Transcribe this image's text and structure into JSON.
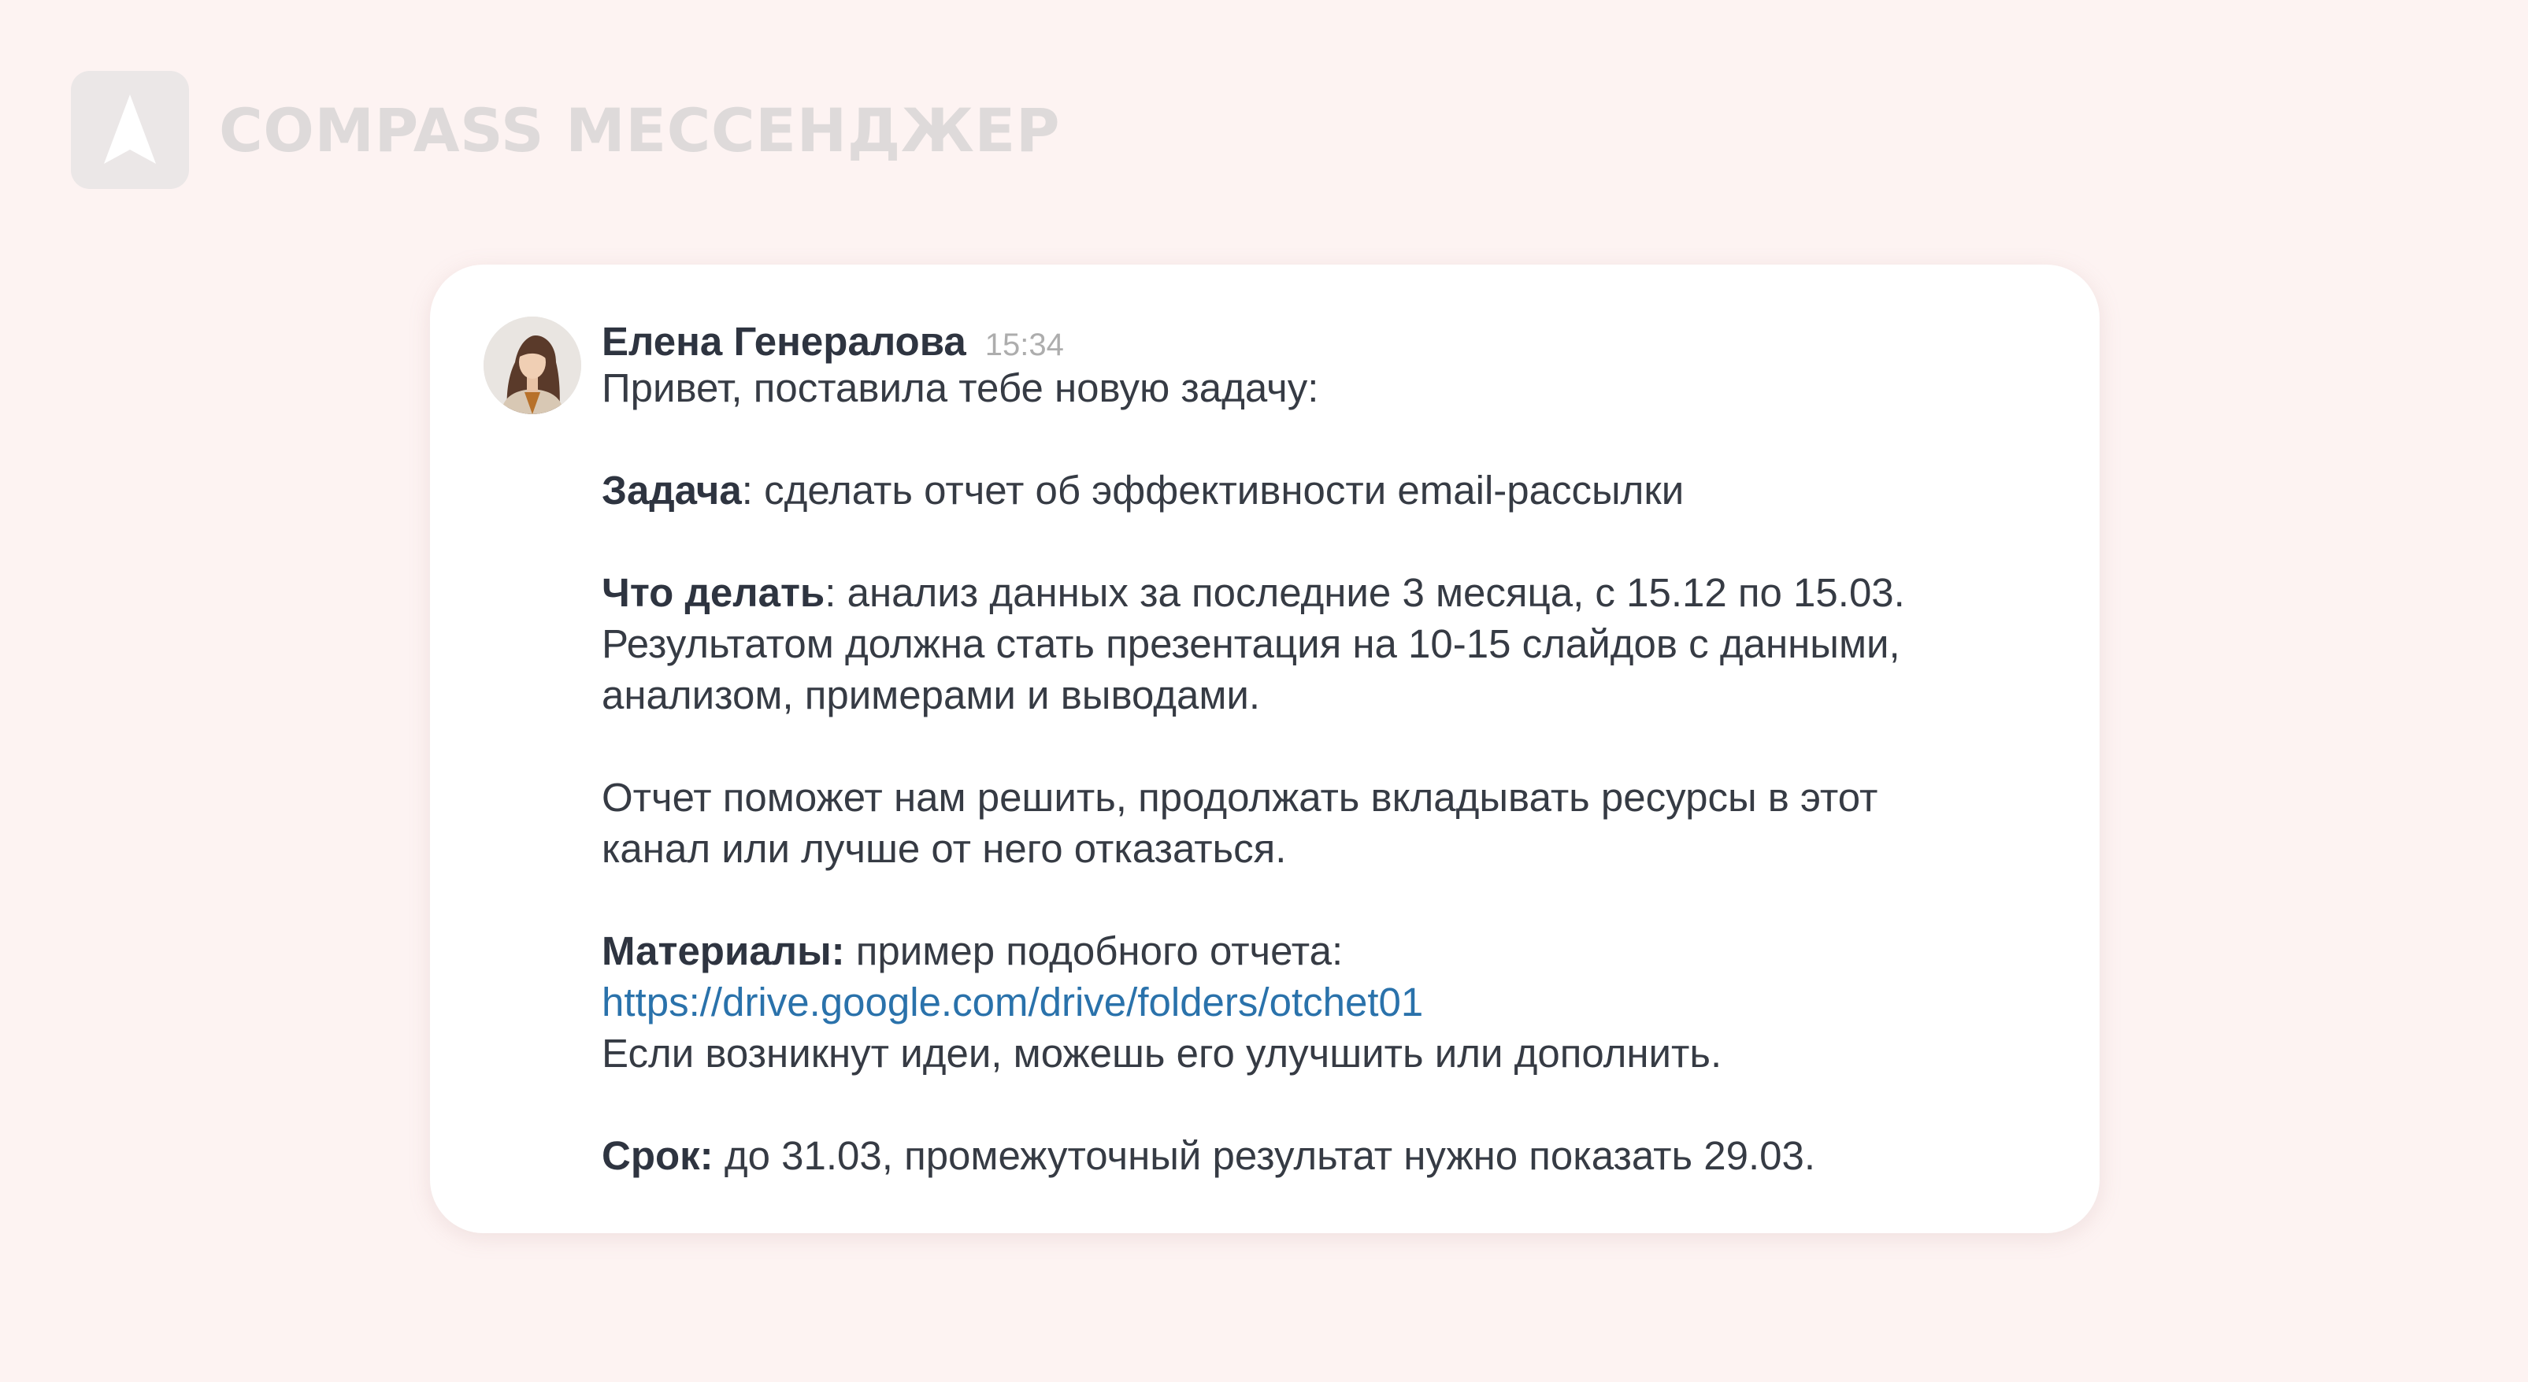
{
  "brand": {
    "name": "COMPASS МЕССЕНДЖЕР",
    "logo_icon": "compass-arrow-icon"
  },
  "colors": {
    "background": "#fdf3f2",
    "card": "#ffffff",
    "text": "#363b44",
    "link": "#2a72ab",
    "time": "#adadad",
    "brand_text": "#dedada"
  },
  "message": {
    "sender": "Елена Генералова",
    "time": "15:34",
    "avatar_icon": "user-avatar",
    "greeting": "Привет, поставила тебе новую задачу:",
    "task_label": "Задача",
    "task_text": ": сделать отчет об эффективности email-рассылки",
    "todo_label": "Что делать",
    "todo_line1": ": анализ данных за последние 3 месяца, с 15.12 по 15.03.",
    "todo_line2": "Результатом должна стать презентация на 10-15 слайдов с данными,",
    "todo_line3": "анализом, примерами и выводами.",
    "purpose_line1": "Отчет поможет нам решить, продолжать вкладывать ресурсы в этот",
    "purpose_line2": "канал или лучше от него отказаться.",
    "materials_label": "Материалы:",
    "materials_text": " пример подобного отчета:",
    "materials_link": "https://drive.google.com/drive/folders/otchet01",
    "materials_note": "Если возникнут идеи, можешь его улучшить или дополнить.",
    "deadline_label": "Срок:",
    "deadline_text": " до 31.03, промежуточный результат нужно показать 29.03."
  }
}
